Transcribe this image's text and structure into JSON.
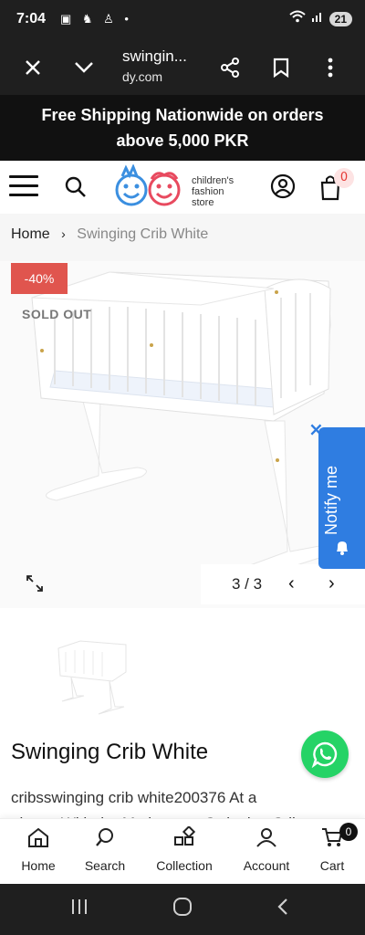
{
  "status": {
    "time": "7:04",
    "battery": "21"
  },
  "browser": {
    "title": "swingin...",
    "domain": "dy.com"
  },
  "promo": {
    "line1": "Free Shipping Nationwide on orders",
    "line2": "above 5,000 PKR"
  },
  "header": {
    "logo_lines": [
      "children's",
      "fashion",
      "store"
    ],
    "cart_count": "0"
  },
  "breadcrumb": {
    "home": "Home",
    "separator": "›",
    "current": "Swinging Crib White"
  },
  "gallery": {
    "discount_badge": "-40%",
    "soldout_badge": "SOLD OUT",
    "page_indicator": "3 / 3",
    "prev": "‹",
    "next": "›"
  },
  "notify": {
    "label": "Notify me",
    "close": "×"
  },
  "product": {
    "title": "Swinging Crib White",
    "description_line1": "cribsswinging crib white200376 At a",
    "description_line2": "glance With the Mothercare Swinging Crib"
  },
  "bottom_nav": {
    "items": [
      {
        "label": "Home",
        "icon": "home-icon"
      },
      {
        "label": "Search",
        "icon": "search-icon"
      },
      {
        "label": "Collection",
        "icon": "grid-icon"
      },
      {
        "label": "Account",
        "icon": "user-icon"
      },
      {
        "label": "Cart",
        "icon": "cart-icon"
      }
    ],
    "cart_count": "0"
  },
  "colors": {
    "brand_red": "#e0554e",
    "notify_blue": "#2f7de1",
    "whatsapp_green": "#25d366"
  }
}
